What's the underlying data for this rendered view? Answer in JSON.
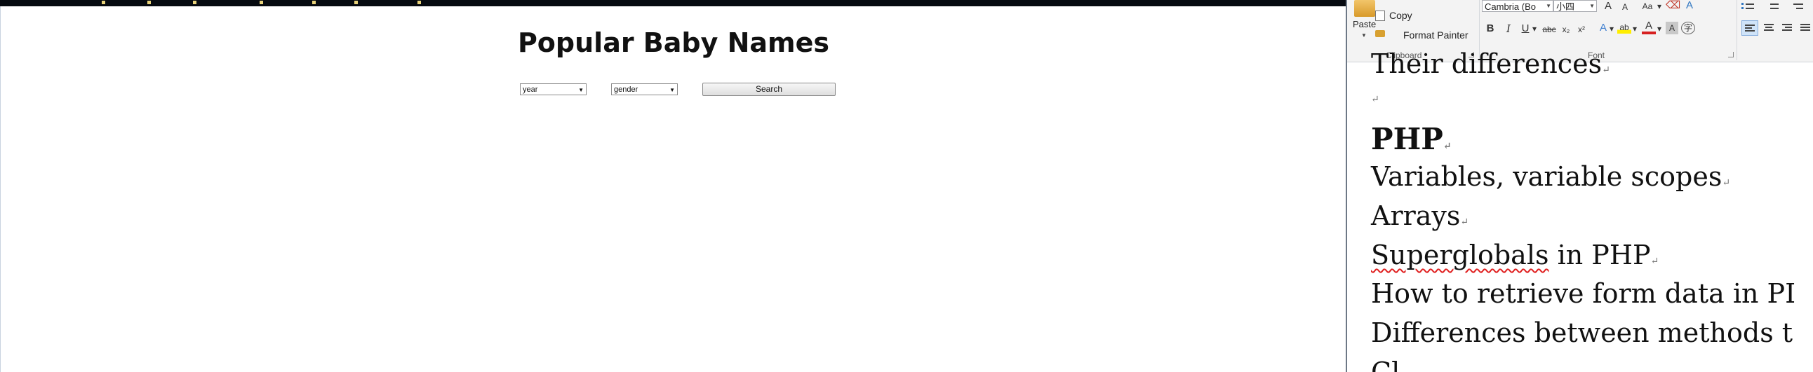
{
  "browser": {
    "page_title": "Popular Baby Names",
    "year_select": "year",
    "gender_select": "gender",
    "search_label": "Search"
  },
  "word": {
    "clipboard": {
      "paste": "Paste",
      "copy": "Copy",
      "format_painter": "Format Painter",
      "group_label": "Clipboard"
    },
    "font": {
      "font_name": "Cambria (Bo",
      "font_size": "小四",
      "group_label": "Font",
      "grow_font": "A",
      "shrink_font": "A",
      "change_case": "Aa",
      "bold": "B",
      "italic": "I",
      "underline": "U",
      "strikethrough": "abc",
      "subscript": "x₂",
      "superscript": "x²"
    },
    "document_lines": [
      "Their differences",
      "",
      "PHP",
      "Variables, variable scopes",
      "Arrays",
      "Superglobals in PHP",
      "How to retrieve form data in PI",
      "Differences between methods t",
      "Cl"
    ]
  }
}
